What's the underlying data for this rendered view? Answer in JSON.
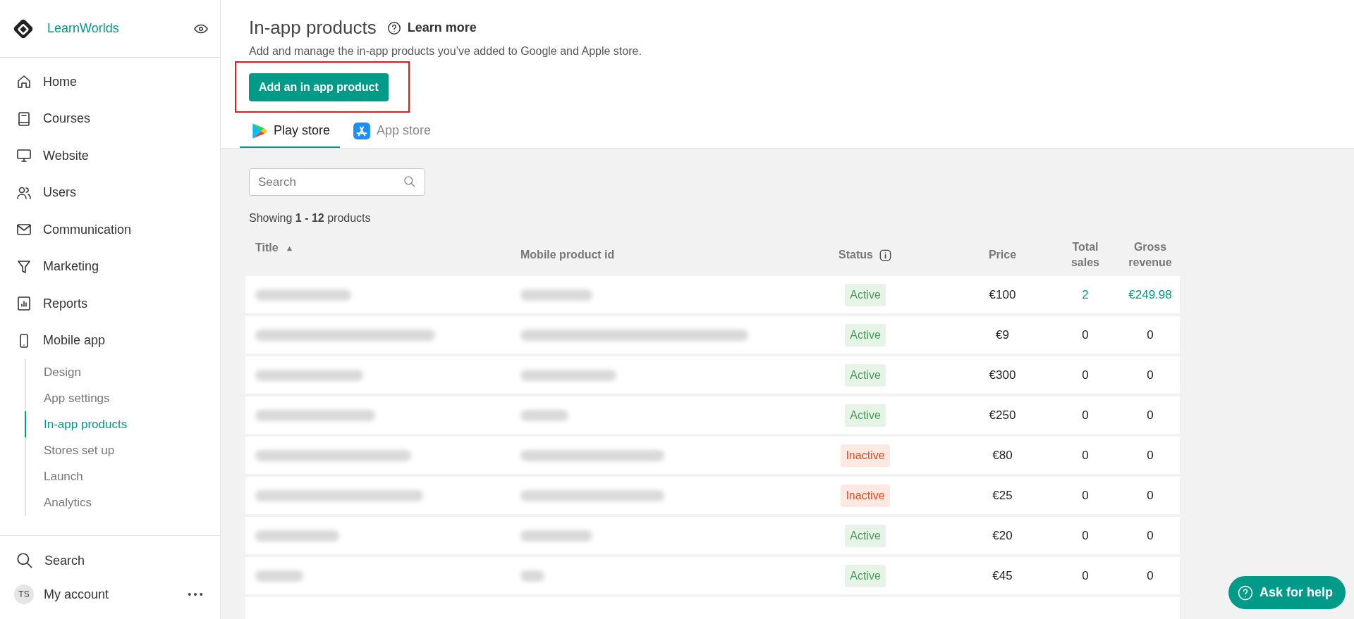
{
  "sidebar": {
    "brand": "LearnWorlds",
    "nav": [
      {
        "label": "Home",
        "selected": false
      },
      {
        "label": "Courses",
        "selected": false
      },
      {
        "label": "Website",
        "selected": false
      },
      {
        "label": "Users",
        "selected": false
      },
      {
        "label": "Communication",
        "selected": false
      },
      {
        "label": "Marketing",
        "selected": false
      },
      {
        "label": "Reports",
        "selected": false
      },
      {
        "label": "Mobile app",
        "selected": false,
        "children": [
          {
            "label": "Design",
            "selected": false
          },
          {
            "label": "App settings",
            "selected": false
          },
          {
            "label": "In-app products",
            "selected": true
          },
          {
            "label": "Stores set up",
            "selected": false
          },
          {
            "label": "Launch",
            "selected": false
          },
          {
            "label": "Analytics",
            "selected": false
          }
        ]
      }
    ],
    "search": "Search",
    "account": {
      "initials": "TS",
      "label": "My account"
    }
  },
  "header": {
    "title": "In-app products",
    "learn_more": "Learn more",
    "subtitle": "Add and manage the in-app products you’ve added to Google and Apple store.",
    "add_button": "Add an in app product"
  },
  "tabs": [
    {
      "label": "Play store",
      "selected": true
    },
    {
      "label": "App store",
      "selected": false
    }
  ],
  "search": {
    "placeholder": "Search"
  },
  "showing": "Showing **1 - 12** products",
  "table": {
    "columns": [
      "Title",
      "Mobile product id",
      "Status",
      "Price",
      "Total sales",
      "Gross revenue"
    ],
    "rows": [
      {
        "status": "Active",
        "active": true,
        "price": "€100",
        "sales": "2",
        "revenue": "€249.98",
        "highlight": true
      },
      {
        "status": "Active",
        "active": true,
        "price": "€9",
        "sales": "0",
        "revenue": "0",
        "highlight": false
      },
      {
        "status": "Active",
        "active": true,
        "price": "€300",
        "sales": "0",
        "revenue": "0",
        "highlight": false
      },
      {
        "status": "Active",
        "active": true,
        "price": "€250",
        "sales": "0",
        "revenue": "0",
        "highlight": false
      },
      {
        "status": "Inactive",
        "active": false,
        "price": "€80",
        "sales": "0",
        "revenue": "0",
        "highlight": false
      },
      {
        "status": "Inactive",
        "active": false,
        "price": "€25",
        "sales": "0",
        "revenue": "0",
        "highlight": false
      },
      {
        "status": "Active",
        "active": true,
        "price": "€20",
        "sales": "0",
        "revenue": "0",
        "highlight": false
      },
      {
        "status": "Active",
        "active": true,
        "price": "€45",
        "sales": "0",
        "revenue": "0",
        "highlight": false
      }
    ]
  },
  "help_button": "Ask for help"
}
